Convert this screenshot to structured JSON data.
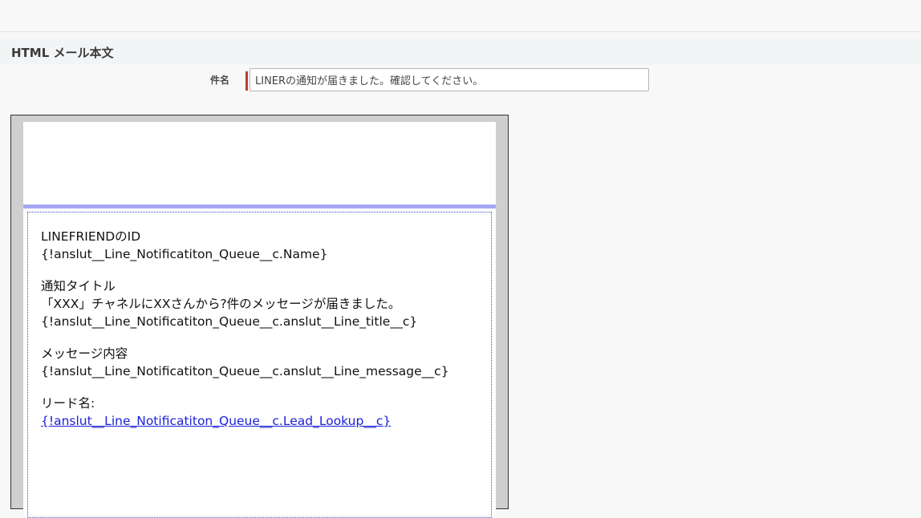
{
  "section": {
    "title": "HTML メール本文"
  },
  "subject": {
    "label": "件名",
    "value": "LINERの通知が届きました。確認してください。"
  },
  "body": {
    "friend_id_label": "LINEFRIENDのID",
    "friend_id_field": "{!anslut__Line_Notificatiton_Queue__c.Name}",
    "title_label": "通知タイトル",
    "title_text": "「XXX」チャネルにXXさんから?件のメッセージが届きました。",
    "title_field": "{!anslut__Line_Notificatiton_Queue__c.anslut__Line_title__c}",
    "message_label": "メッセージ内容",
    "message_field": "{!anslut__Line_Notificatiton_Queue__c.anslut__Line_message__c}",
    "lead_label": "リード名:",
    "lead_field": "{!anslut__Line_Notificatiton_Queue__c.Lead_Lookup__c}"
  },
  "colors": {
    "required_marker": "#c23934",
    "header_divider": "#a8a8f2",
    "link": "#1b1fd6"
  }
}
